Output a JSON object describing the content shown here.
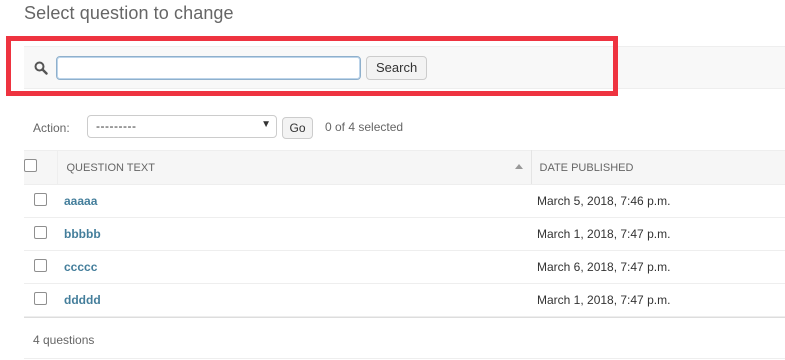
{
  "page": {
    "title": "Select question to change"
  },
  "search": {
    "value": "",
    "placeholder": "",
    "button_label": "Search"
  },
  "actions": {
    "label": "Action:",
    "selected_option": "---------",
    "go_label": "Go",
    "selection_status": "0 of 4 selected"
  },
  "table": {
    "columns": [
      {
        "label": "QUESTION TEXT",
        "sorted": "ascending"
      },
      {
        "label": "DATE PUBLISHED"
      }
    ],
    "rows": [
      {
        "question": "aaaaa",
        "date": "March 5, 2018, 7:46 p.m."
      },
      {
        "question": "bbbbb",
        "date": "March 1, 2018, 7:47 p.m."
      },
      {
        "question": "ccccc",
        "date": "March 6, 2018, 7:47 p.m."
      },
      {
        "question": "ddddd",
        "date": "March 1, 2018, 7:47 p.m."
      }
    ]
  },
  "paginator": {
    "text": "4 questions"
  },
  "colors": {
    "highlight": "#ee3340",
    "link": "#447e9b"
  },
  "icons": {
    "search": "search-icon",
    "sort": "sort-ascending-icon"
  }
}
